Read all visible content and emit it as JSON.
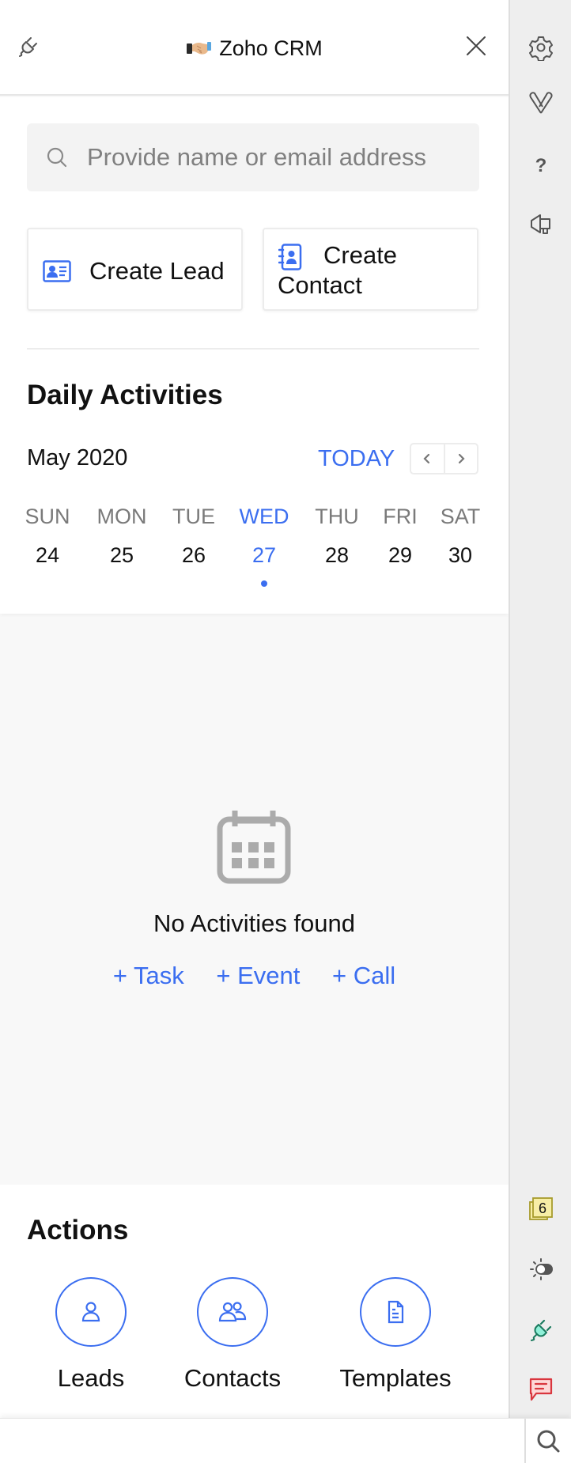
{
  "header": {
    "title": "Zoho CRM",
    "logo_icon": "handshake-icon",
    "left_icon": "plug-icon",
    "close_icon": "close-icon"
  },
  "search": {
    "placeholder": "Provide name or email address",
    "value": "",
    "icon": "search-icon"
  },
  "create": {
    "lead_label": "Create Lead",
    "lead_icon": "id-card-icon",
    "contact_label": "Create Contact",
    "contact_icon": "address-book-icon"
  },
  "daily": {
    "title": "Daily Activities",
    "month": "May 2020",
    "today_label": "TODAY",
    "prev_icon": "chevron-left-icon",
    "next_icon": "chevron-right-icon",
    "days": [
      {
        "name": "SUN",
        "date": "24",
        "active": false
      },
      {
        "name": "MON",
        "date": "25",
        "active": false
      },
      {
        "name": "TUE",
        "date": "26",
        "active": false
      },
      {
        "name": "WED",
        "date": "27",
        "active": true
      },
      {
        "name": "THU",
        "date": "28",
        "active": false
      },
      {
        "name": "FRI",
        "date": "29",
        "active": false
      },
      {
        "name": "SAT",
        "date": "30",
        "active": false
      }
    ],
    "empty_icon": "calendar-icon",
    "empty_text": "No Activities found",
    "quick_add": [
      "+ Task",
      "+ Event",
      "+ Call"
    ]
  },
  "actions": {
    "title": "Actions",
    "items": [
      {
        "label": "Leads",
        "icon": "user-icon"
      },
      {
        "label": "Contacts",
        "icon": "users-icon"
      },
      {
        "label": "Templates",
        "icon": "document-icon"
      }
    ]
  },
  "rail": {
    "top_icons": [
      "gear-icon",
      "paperclip-v-icon",
      "help-icon",
      "megaphone-icon"
    ],
    "bottom_icons": [
      "notes-icon",
      "theme-toggle-icon",
      "plug-connected-icon",
      "chat-icon"
    ],
    "notes_count": "6"
  },
  "colors": {
    "accent": "#3b6ef0",
    "rail_bg": "#eeeeee",
    "panel_bg": "#f8f8f8",
    "notes_fill": "#f7eea6",
    "notes_border": "#a79b2c",
    "plug_fill": "#8ff0d8",
    "plug_stroke": "#1a7a5e",
    "chat_fill": "#fdd8d8",
    "chat_stroke": "#d9363e"
  }
}
